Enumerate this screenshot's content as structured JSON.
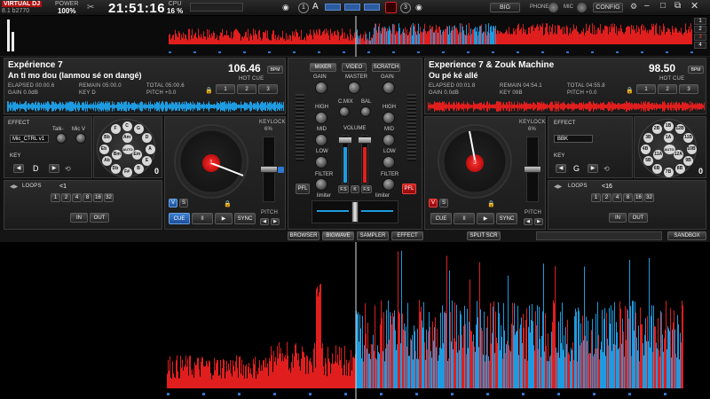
{
  "topbar": {
    "logo": "VIRTUAL DJ",
    "version": "8.1 b2770",
    "power_label": "POWER",
    "power_value": "100%",
    "clock": "21:51:16",
    "cpu_label": "CPU",
    "cpu_value": "16 %",
    "deck1_num": "1",
    "deck2_num": "2",
    "deck3_num": "3",
    "letter_a": "A",
    "big_label": "BIG",
    "phone_label": "PHONE",
    "mic_label": "MIC",
    "config_label": "CONFIG",
    "sidebar_nums": [
      "1",
      "2",
      "3",
      "4"
    ]
  },
  "deck_left": {
    "artist": "Expérience 7",
    "title": "An ti mo dou (lanmou sé on dangé)",
    "bpm": "106.46",
    "bpm_unit": "BPM",
    "elapsed": "ELAPSED 00:00.6",
    "remain": "REMAIN 05:00.0",
    "total": "TOTAL 05:00.6",
    "gain": "GAIN 0.0dB",
    "key": "KEY D",
    "pitch": "PITCH +0.0",
    "hot_cue": "HOT CUE",
    "hot_cues": [
      "1",
      "2",
      "3"
    ],
    "effect_label": "EFFECT",
    "effect_value": "Mic_CTRL v1",
    "talk": "Talk-",
    "micv": "Mic V",
    "key_label": "KEY",
    "key_value": "D",
    "keylock": "KEYLOCK",
    "keylock_pct": "6%",
    "loops": "LOOPS",
    "loop_size": "<1",
    "loop_buttons": [
      "1",
      "2",
      "4",
      "8",
      "16",
      "32"
    ],
    "in": "IN",
    "out": "OUT",
    "cue": "CUE",
    "play_pause": "II",
    "play": "▶",
    "sync": "SYNC",
    "pitch_label": "PITCH",
    "v": "V",
    "s": "S",
    "platter_num": "1",
    "zero": "0"
  },
  "deck_right": {
    "artist": "Experience 7 & Zouk Machine",
    "title": "Ou pé ké allé",
    "bpm": "98.50",
    "bpm_unit": "BPM",
    "elapsed": "ELAPSED 00:01.8",
    "remain": "REMAIN 04:54.1",
    "total": "TOTAL 04:55.8",
    "gain": "GAIN 0.0dB",
    "key": "KEY 09B",
    "pitch": "PITCH +0.0",
    "hot_cue": "HOT CUE",
    "hot_cues": [
      "1",
      "2",
      "3"
    ],
    "effect_label": "EFFECT",
    "effect_value": "BBK",
    "key_label": "KEY",
    "key_value": "G",
    "keylock": "KEYLOCK",
    "keylock_pct": "6%",
    "loops": "LOOPS",
    "loop_size": "<16",
    "loop_buttons": [
      "1",
      "2",
      "4",
      "8",
      "16",
      "32"
    ],
    "in": "IN",
    "out": "OUT",
    "cue": "CUE",
    "play_pause": "II",
    "play": "▶",
    "sync": "SYNC",
    "pitch_label": "PITCH",
    "v": "V",
    "s": "S",
    "platter_num": "3",
    "zero": "0"
  },
  "keywheel_left": [
    "C",
    "G",
    "D",
    "A",
    "E",
    "B",
    "F#",
    "Db",
    "Ab",
    "Eb",
    "Bb",
    "F",
    "Am",
    "Em",
    "Bm",
    "AUTO"
  ],
  "keywheel_right": [
    "1B",
    "12B",
    "11B",
    "10B",
    "9B",
    "8B",
    "7B",
    "6B",
    "5B",
    "4B",
    "3B",
    "2B",
    "1A",
    "12A",
    "11A",
    "AUTO"
  ],
  "mixer": {
    "tab_mixer": "MIXER",
    "tab_video": "VIDEO",
    "tab_scratch": "SCRATCH",
    "gain": "GAIN",
    "master": "MASTER",
    "high": "HIGH",
    "cmix": "C.MIX",
    "bal": "BAL",
    "mid": "MID",
    "low": "LOW",
    "volume": "VOLUME",
    "filter": "FILTER",
    "pfl": "PFL",
    "fs": "F.S",
    "limiter": "limiter"
  },
  "bottom_tabs": {
    "browser": "BROWSER",
    "bigwave": "BIGWAVE",
    "sampler": "SAMPLER",
    "effect": "EFFECT",
    "split": "SPLIT SCR",
    "sandbox": "SANDBOX"
  },
  "colors": {
    "deck_left": "#1e9be0",
    "deck_right": "#e01e1e",
    "accent_blue": "#3a8ad8"
  }
}
